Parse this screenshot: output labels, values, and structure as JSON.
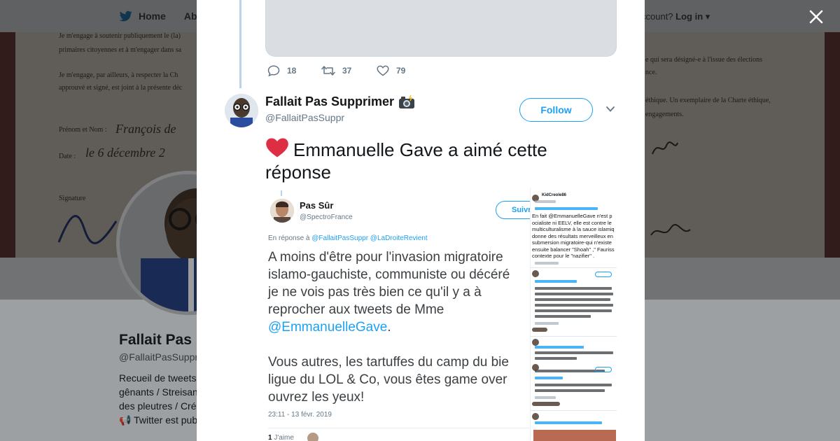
{
  "background": {
    "nav": {
      "home_label": "Home",
      "about_label": "Abo"
    },
    "account": {
      "prompt": "ccount?",
      "login_label": "Log in"
    },
    "banner_lines": [
      "Je m'engage à soutenir publiquement le (la)",
      "primaires citoyennes et à m'engager dans sa",
      "Je m'engage, par ailleurs, à respecter la Ch",
      "approuvé et signé, est joint à la présente déc",
      "Prénom et Nom :",
      "Date :",
      "Signature",
      "e qui sera désigné-e à l'issue des élections",
      "nce.",
      "éthique. Un exemplaire de la Charte éthique,",
      "engagements."
    ],
    "handwriting": [
      "François de",
      "le 6 décembre 2"
    ],
    "profile": {
      "name": "Fallait Pas",
      "handle": "@FallaitPasSuppr",
      "bio_lines": [
        "Recueil de tweets",
        "gênants / Streisan",
        "des pleutres / Cré",
        "Twitter est pub"
      ]
    }
  },
  "previous_tweet": {
    "actions": {
      "replies": "18",
      "retweets": "37",
      "likes": "79"
    }
  },
  "tweet": {
    "author_name": "Fallait Pas Supprimer",
    "author_emoji": "camera-flash-emoji",
    "author_handle": "@FallaitPasSuppr",
    "follow_label": "Follow",
    "text": "Emmanuelle Gave a aimé cette réponse",
    "heart_color": "#e0245e"
  },
  "embedded_screenshot": {
    "name": "Pas Sûr",
    "handle": "@SpectroFrance",
    "follow_label": "Suivre",
    "reply_prefix": "En réponse à",
    "reply_to": "@FallaitPasSuppr @LaDroiteRevient",
    "paragraph1": [
      "A moins d'être pour l'invasion migratoire",
      "islamo-gauchiste, communiste ou décéré",
      "je ne vois pas très bien ce qu'il y a à",
      "reprocher aux tweets de Mme"
    ],
    "mention": "@EmmanuelleGave",
    "mention_suffix": ".",
    "paragraph2": [
      "Vous autres, les tartuffes du camp du bie",
      "ligue du LOL & Co, vous êtes game over",
      "ouvrez les yeux!"
    ],
    "date": "23:11 - 13 févr. 2019",
    "likes_count": "1",
    "likes_label": "J'aime"
  },
  "mini_screenshot": {
    "name": "KidCreole86",
    "lines": [
      "En fait @EmmanuelleGave n'est p",
      "ocialiste ni EELV, elle est contre le",
      "multiculturalisme à la sauce islamiq",
      "donne des résultats merveilleux en",
      "submersion migratoire-qui n'existe",
      "ensuite balancer \"Shoah\" ,\" Fauriss",
      "contexte pour le \"nazifier\" ."
    ]
  },
  "colors": {
    "accent": "#1da1f2",
    "text": "#14171a",
    "muted": "#657786"
  }
}
